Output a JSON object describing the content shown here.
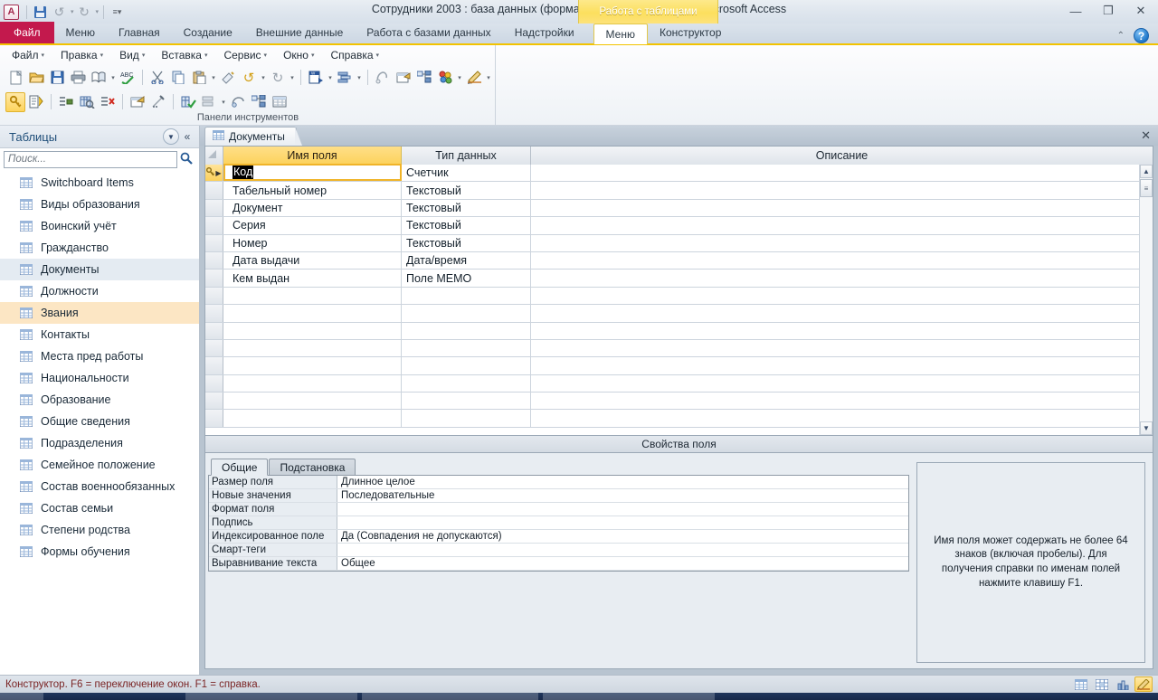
{
  "window": {
    "title": "Сотрудники 2003 : база данных (формат Access 2002 - 2003)  -  Microsoft Access",
    "logo": "A",
    "contextual_group": "Работа с таблицами",
    "minimize": "—",
    "restore": "❐",
    "close": "✕"
  },
  "quick_access": {
    "save": "save-icon",
    "undo": "↺",
    "redo": "↻",
    "customize": "▾"
  },
  "ribbon": {
    "tabs": [
      {
        "label": "Файл",
        "kind": "file"
      },
      {
        "label": "Меню",
        "kind": "normal"
      },
      {
        "label": "Главная",
        "kind": "normal"
      },
      {
        "label": "Создание",
        "kind": "normal"
      },
      {
        "label": "Внешние данные",
        "kind": "normal"
      },
      {
        "label": "Работа с базами данных",
        "kind": "normal"
      },
      {
        "label": "Надстройки",
        "kind": "normal"
      },
      {
        "label": "Меню",
        "kind": "ctx-active"
      },
      {
        "label": "Конструктор",
        "kind": "ctx"
      }
    ],
    "collapse_icon": "⌃",
    "help_icon": "?"
  },
  "legacy_toolbar": {
    "group_label": "Панели инструментов",
    "menus": [
      "Файл",
      "Правка",
      "Вид",
      "Вставка",
      "Сервис",
      "Окно",
      "Справка"
    ],
    "row1_icons": [
      "new-document-icon",
      "open-folder-icon",
      "save-icon",
      "print-icon",
      "print-preview-icon",
      "spellcheck-icon",
      "cut-scissors-icon",
      "copy-icon",
      "paste-icon",
      "format-painter-icon",
      "undo-icon",
      "redo-icon",
      "word-export-icon",
      "analyze-icon",
      "relationships-icon",
      "object-dependencies-icon",
      "new-object-icon",
      "macro-icon",
      "toolbar-options-icon"
    ],
    "row2_icons": [
      "primary-key-icon",
      "build-icon",
      "insert-rows-icon",
      "indexes-icon",
      "delete-rows-icon",
      "properties-icon",
      "lookup-wizard-icon",
      "test-validation-icon",
      "sort-icon",
      "relationships2-icon",
      "new-object2-icon",
      "datasheet-view-icon"
    ]
  },
  "nav_pane": {
    "title": "Таблицы",
    "dropdown_icon": "▼",
    "collapse_icon": "«",
    "search_placeholder": "Поиск...",
    "search_value": "",
    "search_icon": "search-icon",
    "items": [
      {
        "label": "Switchboard Items",
        "state": "normal"
      },
      {
        "label": "Виды образования",
        "state": "normal"
      },
      {
        "label": "Воинский учёт",
        "state": "normal"
      },
      {
        "label": "Гражданство",
        "state": "normal"
      },
      {
        "label": "Документы",
        "state": "open"
      },
      {
        "label": "Должности",
        "state": "normal"
      },
      {
        "label": "Звания",
        "state": "selected"
      },
      {
        "label": "Контакты",
        "state": "normal"
      },
      {
        "label": "Места пред работы",
        "state": "normal"
      },
      {
        "label": "Национальности",
        "state": "normal"
      },
      {
        "label": "Образование",
        "state": "normal"
      },
      {
        "label": "Общие сведения",
        "state": "normal"
      },
      {
        "label": "Подразделения",
        "state": "normal"
      },
      {
        "label": "Семейное положение",
        "state": "normal"
      },
      {
        "label": "Состав военнообязанных",
        "state": "normal"
      },
      {
        "label": "Состав семьи",
        "state": "normal"
      },
      {
        "label": "Степени родства",
        "state": "normal"
      },
      {
        "label": "Формы обучения",
        "state": "normal"
      }
    ]
  },
  "document": {
    "tab_label": "Документы",
    "tab_icon": "table-icon",
    "close_icon": "✕"
  },
  "grid": {
    "headers": {
      "field_name": "Имя поля",
      "data_type": "Тип данных",
      "description": "Описание"
    },
    "rows": [
      {
        "field_name": "Код",
        "data_type": "Счетчик",
        "description": "",
        "primary_key": true,
        "active": true
      },
      {
        "field_name": "Табельный номер",
        "data_type": "Текстовый",
        "description": "",
        "primary_key": false,
        "active": false
      },
      {
        "field_name": "Документ",
        "data_type": "Текстовый",
        "description": "",
        "primary_key": false,
        "active": false
      },
      {
        "field_name": "Серия",
        "data_type": "Текстовый",
        "description": "",
        "primary_key": false,
        "active": false
      },
      {
        "field_name": "Номер",
        "data_type": "Текстовый",
        "description": "",
        "primary_key": false,
        "active": false
      },
      {
        "field_name": "Дата выдачи",
        "data_type": "Дата/время",
        "description": "",
        "primary_key": false,
        "active": false
      },
      {
        "field_name": "Кем выдан",
        "data_type": "Поле MEMO",
        "description": "",
        "primary_key": false,
        "active": false
      }
    ],
    "empty_rows": 8,
    "scroll_up_icon": "▲",
    "scroll_down_icon": "▼"
  },
  "field_properties": {
    "section_label": "Свойства поля",
    "tabs": [
      {
        "label": "Общие",
        "selected": true
      },
      {
        "label": "Подстановка",
        "selected": false
      }
    ],
    "properties": [
      {
        "name": "Размер поля",
        "value": "Длинное целое"
      },
      {
        "name": "Новые значения",
        "value": "Последовательные"
      },
      {
        "name": "Формат поля",
        "value": ""
      },
      {
        "name": "Подпись",
        "value": ""
      },
      {
        "name": "Индексированное поле",
        "value": "Да (Совпадения не допускаются)"
      },
      {
        "name": "Смарт-теги",
        "value": ""
      },
      {
        "name": "Выравнивание текста",
        "value": "Общее"
      }
    ],
    "help_text": "Имя поля может содержать не более 64 знаков (включая пробелы). Для получения справки по именам полей нажмите клавишу F1."
  },
  "status_bar": {
    "text": "Конструктор.  F6 = переключение окон.  F1 = справка.",
    "view_buttons": [
      {
        "name": "datasheet-view",
        "selected": false
      },
      {
        "name": "pivottable-view",
        "selected": false
      },
      {
        "name": "pivotchart-view",
        "selected": false
      },
      {
        "name": "design-view",
        "selected": true
      }
    ]
  },
  "colors": {
    "file_tab": "#c3194d",
    "accent_yellow": "#f2c300",
    "contextual_yellow": "#fcdf5e",
    "nav_title": "#1f4e79",
    "status_text": "#7a2424",
    "selection_black": "#000000",
    "nav_selected": "#fce6c4",
    "nav_open": "#e4ebf2"
  }
}
